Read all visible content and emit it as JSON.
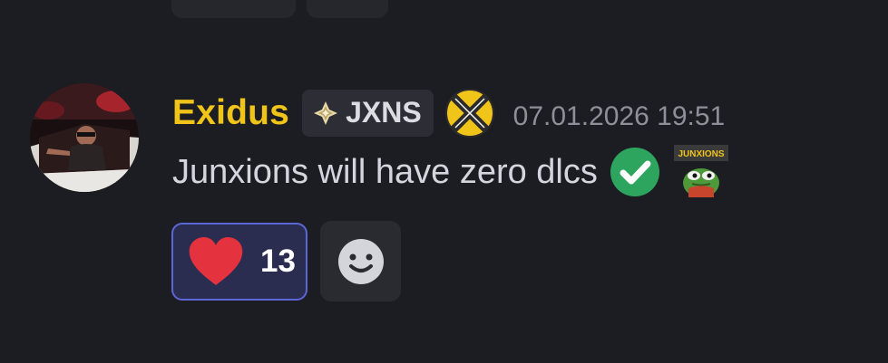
{
  "message": {
    "author": "Exidus",
    "tag": "JXNS",
    "timestamp": "07.01.2026 19:51",
    "text": "Junxions will have zero dlcs",
    "inline_emojis": [
      "check-mark-icon",
      "pepe-junxions-icon"
    ]
  },
  "server_badge": {
    "label": "JUNXIONS"
  },
  "reactions": [
    {
      "emoji": "heart-icon",
      "count": "13",
      "active": true
    }
  ],
  "add_reaction": {
    "icon": "smile-icon"
  },
  "colors": {
    "background": "#1c1d22",
    "username": "#f0c419",
    "reaction_active_bg": "#2a2c50",
    "reaction_active_border": "#5d66d6",
    "heart": "#e5323f",
    "check": "#2ea55f"
  }
}
